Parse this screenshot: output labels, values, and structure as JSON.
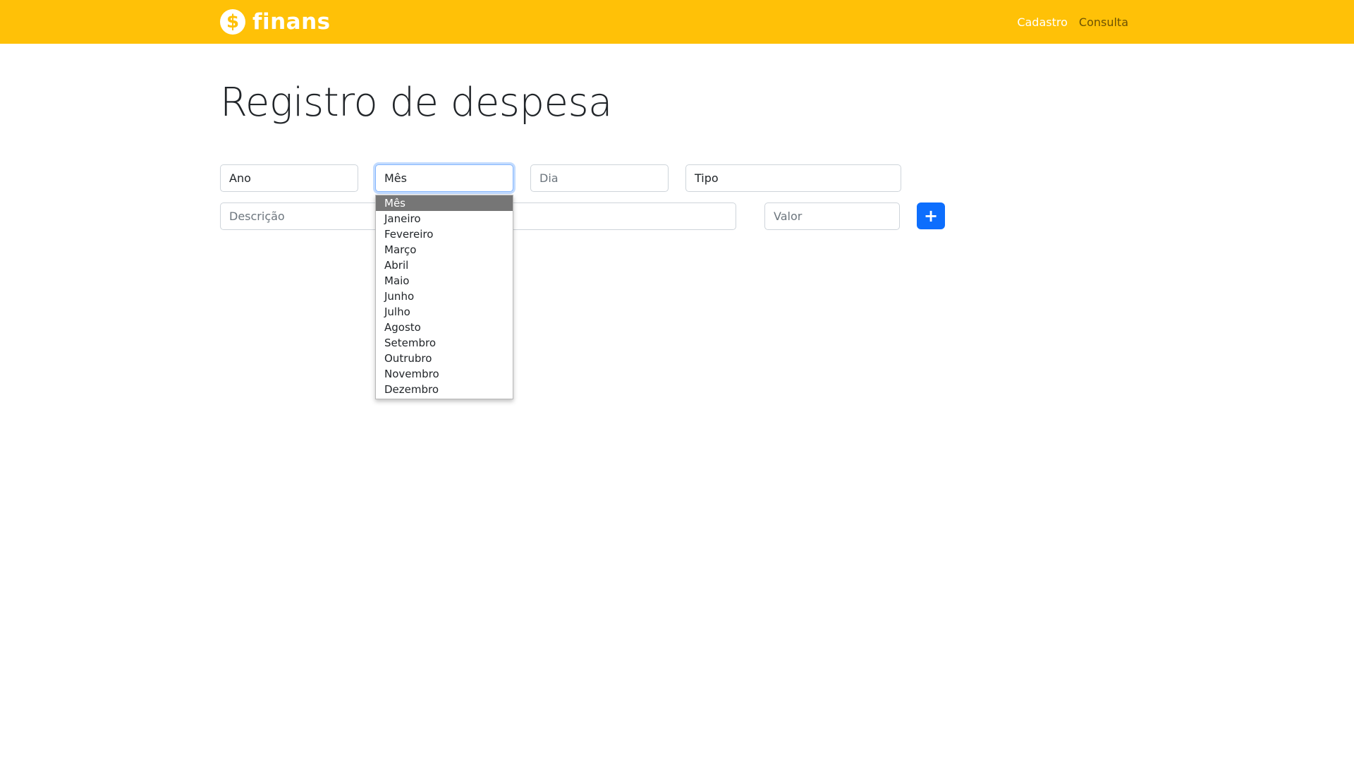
{
  "navbar": {
    "brand_icon": "$",
    "brand_name": "finans",
    "links": [
      {
        "label": "Cadastro",
        "active": true
      },
      {
        "label": "Consulta",
        "active": false
      }
    ]
  },
  "page": {
    "title": "Registro de despesa"
  },
  "form": {
    "ano": "Ano",
    "mes": "Mês",
    "dia_placeholder": "Dia",
    "tipo": "Tipo",
    "descricao_placeholder": "Descrição",
    "valor_placeholder": "Valor",
    "add_icon": "+"
  },
  "month_dropdown": {
    "selected": "Mês",
    "options": [
      "Mês",
      "Janeiro",
      "Fevereiro",
      "Março",
      "Abril",
      "Maio",
      "Junho",
      "Julho",
      "Agosto",
      "Setembro",
      "Outrubro",
      "Novembro",
      "Dezembro"
    ]
  },
  "colors": {
    "navbar_bg": "#ffc107",
    "primary_button": "#0d6efd",
    "selected_option_bg": "#767676"
  },
  "icons": {
    "brand": "dollar-circle-icon",
    "add": "plus-icon"
  }
}
